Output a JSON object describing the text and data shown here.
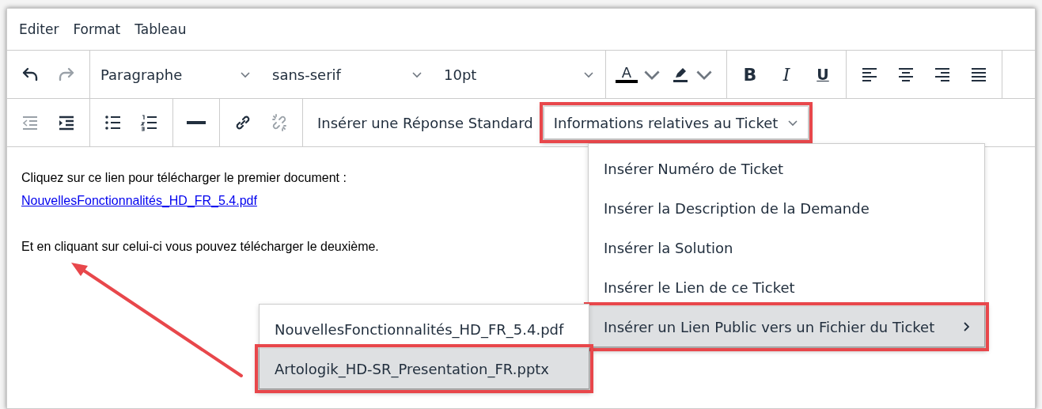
{
  "menubar": [
    "Editer",
    "Format",
    "Tableau"
  ],
  "toolbar_rows": [
    [
      {
        "tools": [
          {
            "kind": "undo",
            "disabled": false
          },
          {
            "kind": "redo",
            "disabled": true
          }
        ]
      },
      {
        "dropdowns": [
          {
            "label": "Paragraphe"
          },
          {
            "label": "sans-serif"
          },
          {
            "label": "10pt"
          }
        ]
      },
      {
        "tools": [
          {
            "kind": "textcolor",
            "glyph": "A",
            "disabled": false
          },
          {
            "kind": "highlight",
            "disabled": false
          }
        ]
      },
      {
        "tools": [
          {
            "kind": "bold",
            "glyph": "B",
            "disabled": false
          },
          {
            "kind": "italic",
            "glyph": "I",
            "disabled": false
          },
          {
            "kind": "underline",
            "glyph": "U",
            "disabled": false
          }
        ]
      },
      {
        "tools": [
          {
            "kind": "alignleft",
            "disabled": false
          },
          {
            "kind": "aligncenter",
            "disabled": false
          },
          {
            "kind": "alignright",
            "disabled": false
          },
          {
            "kind": "justify",
            "disabled": false
          }
        ]
      }
    ],
    [
      {
        "tools": [
          {
            "kind": "outdent",
            "disabled": true
          },
          {
            "kind": "indent",
            "disabled": false
          }
        ]
      },
      {
        "tools": [
          {
            "kind": "bullets",
            "disabled": false
          },
          {
            "kind": "numbers",
            "disabled": false
          }
        ]
      },
      {
        "tools": [
          {
            "kind": "rule",
            "disabled": false
          }
        ]
      },
      {
        "tools": [
          {
            "kind": "link",
            "disabled": false
          },
          {
            "kind": "unlink",
            "disabled": true
          }
        ]
      },
      {
        "menus": [
          {
            "label": "Insérer une Réponse Standard",
            "caret": false,
            "annotated": false
          },
          {
            "label": "Informations relatives au Ticket",
            "caret": true,
            "annotated": true
          }
        ]
      }
    ]
  ],
  "content": [
    {
      "kind": "text",
      "text": "Cliquez sur ce lien pour télécharger le premier document :"
    },
    {
      "kind": "link",
      "text": "NouvellesFonctionnalités_HD_FR_5.4.pdf"
    },
    {
      "kind": "blank"
    },
    {
      "kind": "text",
      "text": "Et en cliquant sur celui-ci vous pouvez télécharger le deuxième."
    }
  ],
  "menu": {
    "items": [
      {
        "label": "Insérer Numéro de Ticket",
        "selected": false,
        "submenu": false,
        "annotated": false
      },
      {
        "label": "Insérer la Description de la Demande",
        "selected": false,
        "submenu": false,
        "annotated": false
      },
      {
        "label": "Insérer la Solution",
        "selected": false,
        "submenu": false,
        "annotated": false
      },
      {
        "label": "Insérer le Lien de ce Ticket",
        "selected": false,
        "submenu": false,
        "annotated": false
      },
      {
        "label": "Insérer un Lien Public vers un Fichier du Ticket",
        "selected": true,
        "submenu": true,
        "annotated": true
      }
    ]
  },
  "submenu": {
    "items": [
      {
        "label": "NouvellesFonctionnalités_HD_FR_5.4.pdf",
        "selected": false,
        "annotated": false
      },
      {
        "label": "Artologik_HD-SR_Presentation_FR.pptx",
        "selected": true,
        "annotated": true
      }
    ]
  }
}
